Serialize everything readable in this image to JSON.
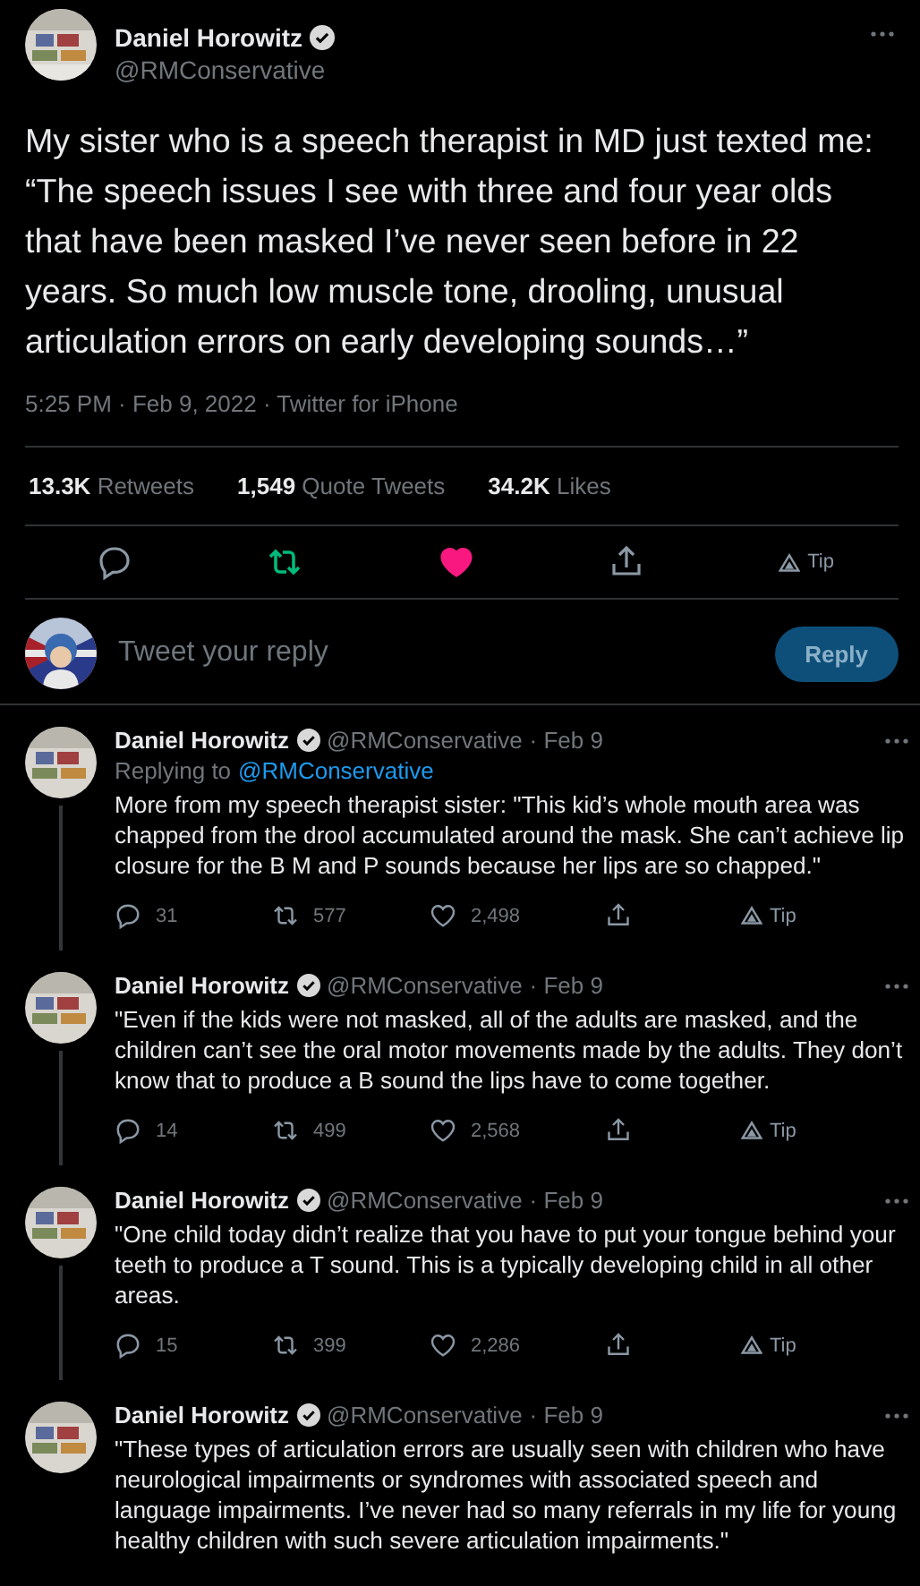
{
  "tweet": {
    "author": {
      "name": "Daniel Horowitz",
      "handle": "@RMConservative",
      "verified": true
    },
    "text": "My sister who is a speech therapist in MD just texted me: “The speech issues I see with three and four year olds that have been masked I’ve never seen before in 22 years. So much low muscle tone, drooling, unusual articulation errors on early developing sounds…”",
    "meta": "5:25 PM · Feb 9, 2022 · Twitter for iPhone",
    "stats": [
      "**13.3K** Retweets",
      "**1,549** Quote Tweets",
      "**34.2K** Likes"
    ],
    "actions": [
      {
        "kind": "reply",
        "active": false
      },
      {
        "kind": "retweet",
        "active": true
      },
      {
        "kind": "like",
        "active": true
      },
      {
        "kind": "share",
        "active": false
      },
      {
        "kind": "tip",
        "active": false,
        "label": "Tip"
      }
    ]
  },
  "composer": {
    "placeholder": "Tweet your reply",
    "button": "Reply"
  },
  "replies": [
    {
      "name": "Daniel Horowitz",
      "verified": true,
      "handle": "@RMConservative",
      "date": "· Feb 9",
      "replying_prefix": "Replying to",
      "replying_to": "@RMConservative",
      "text": "More from my speech therapist sister: \"This kid’s whole mouth area was chapped from the drool accumulated around the mask. She can’t achieve lip closure for the B M and P sounds because her lips are so chapped.\"",
      "counts": {
        "replies": "31",
        "retweets": "577",
        "likes": "2,498",
        "tip": "Tip"
      }
    },
    {
      "name": "Daniel Horowitz",
      "verified": true,
      "handle": "@RMConservative",
      "date": "· Feb 9",
      "text": "\"Even if the kids were not masked, all of the adults are masked, and the children can’t see the oral motor movements made by the adults. They don’t know that to produce a B sound the lips have to come together.",
      "counts": {
        "replies": "14",
        "retweets": "499",
        "likes": "2,568",
        "tip": "Tip"
      }
    },
    {
      "name": "Daniel Horowitz",
      "verified": true,
      "handle": "@RMConservative",
      "date": "· Feb 9",
      "text": "\"One child today didn’t realize that you have to put your tongue behind your teeth to produce a T sound. This is a typically developing child in all other areas.",
      "counts": {
        "replies": "15",
        "retweets": "399",
        "likes": "2,286",
        "tip": "Tip"
      }
    },
    {
      "name": "Daniel Horowitz",
      "verified": true,
      "handle": "@RMConservative",
      "date": "· Feb 9",
      "text": "\"These types of articulation errors are usually seen with children who have neurological impairments or syndromes with associated speech and language impairments. I’ve never had so many referrals in my life for young healthy children with such severe articulation impairments.\""
    }
  ]
}
